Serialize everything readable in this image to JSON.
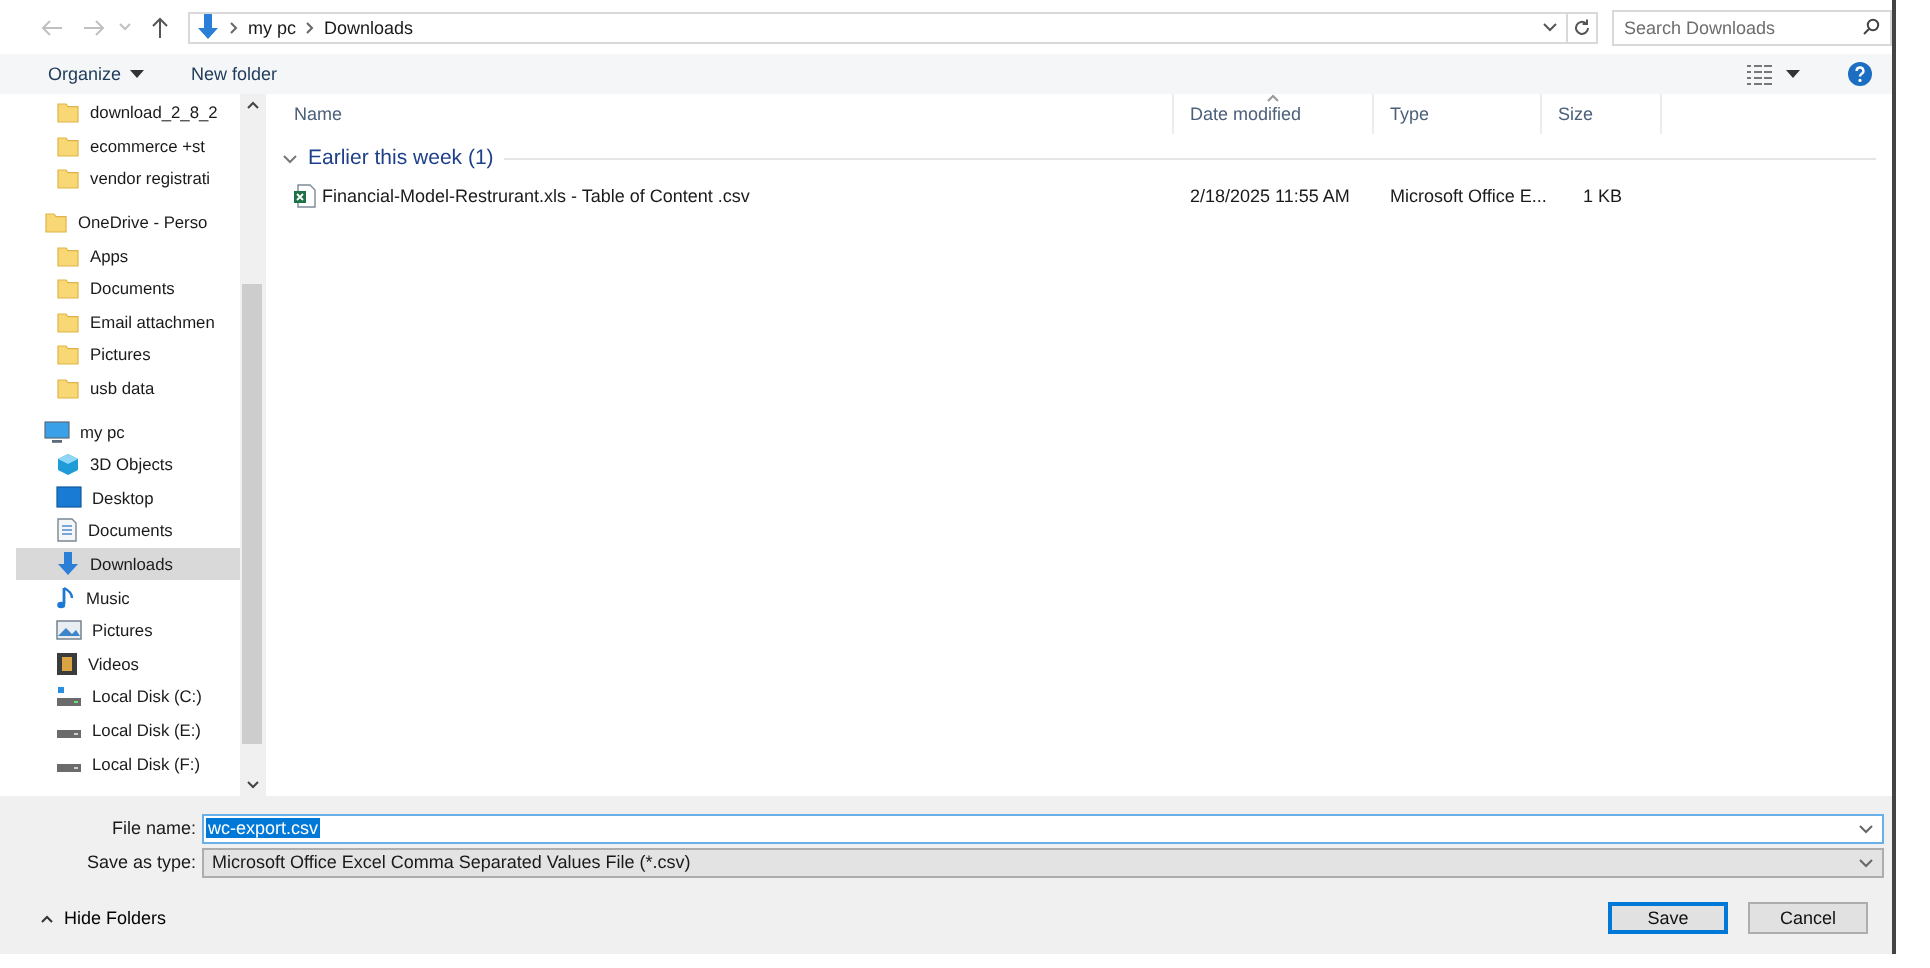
{
  "address_bar": {
    "crumbs": [
      "my pc",
      "Downloads"
    ]
  },
  "search": {
    "placeholder": "Search Downloads"
  },
  "toolbar": {
    "buttons": [
      "Organize",
      "New folder"
    ]
  },
  "sidebar": {
    "continued_items": [
      {
        "label": "download_2_8_2",
        "kind": "folder",
        "selected": false
      },
      {
        "label": "ecommerce +st",
        "kind": "folder",
        "selected": false
      },
      {
        "label": "vendor registrati",
        "kind": "folder",
        "selected": false
      }
    ],
    "items": [
      {
        "label": "OneDrive - Perso",
        "kind": "folder",
        "selected": false,
        "children": [
          {
            "label": "Apps",
            "kind": "folder",
            "selected": false
          },
          {
            "label": "Documents",
            "kind": "folder",
            "selected": false
          },
          {
            "label": "Email attachmen",
            "kind": "folder",
            "selected": false
          },
          {
            "label": "Pictures",
            "kind": "folder",
            "selected": false
          },
          {
            "label": "usb data",
            "kind": "folder",
            "selected": false
          }
        ]
      },
      {
        "label": "my pc",
        "kind": "pc",
        "selected": false,
        "children": [
          {
            "label": "3D Objects",
            "kind": "cube",
            "selected": false
          },
          {
            "label": "Desktop",
            "kind": "desktop",
            "selected": false
          },
          {
            "label": "Documents",
            "kind": "documents",
            "selected": false
          },
          {
            "label": "Downloads",
            "kind": "downloads",
            "selected": true
          },
          {
            "label": "Music",
            "kind": "music",
            "selected": false
          },
          {
            "label": "Pictures",
            "kind": "pictures",
            "selected": false
          },
          {
            "label": "Videos",
            "kind": "videos",
            "selected": false
          },
          {
            "label": "Local Disk (C:)",
            "kind": "system-drive",
            "selected": false
          },
          {
            "label": "Local Disk (E:)",
            "kind": "drive",
            "selected": false
          },
          {
            "label": "Local Disk (F:)",
            "kind": "drive",
            "selected": false
          }
        ]
      }
    ]
  },
  "file_list": {
    "columns": [
      "Name",
      "Date modified",
      "Type",
      "Size"
    ],
    "groups": [
      {
        "title": "Earlier this week (1)",
        "expanded": true,
        "rows": [
          {
            "name": "Financial-Model-Restrurant.xls - Table of Content .csv",
            "date_modified": "2/18/2025 11:55 AM",
            "type": "Microsoft Office E...",
            "size": "1 KB"
          }
        ]
      }
    ]
  },
  "file_name": {
    "label": "File name:",
    "value": "wc-export.csv",
    "value_selected": true
  },
  "save_as_type": {
    "label": "Save as type:",
    "value": "Microsoft Office Excel Comma Separated Values File (*.csv)"
  },
  "hide_folders": {
    "label": "Hide Folders"
  },
  "buttons": [
    "Save",
    "Cancel"
  ]
}
